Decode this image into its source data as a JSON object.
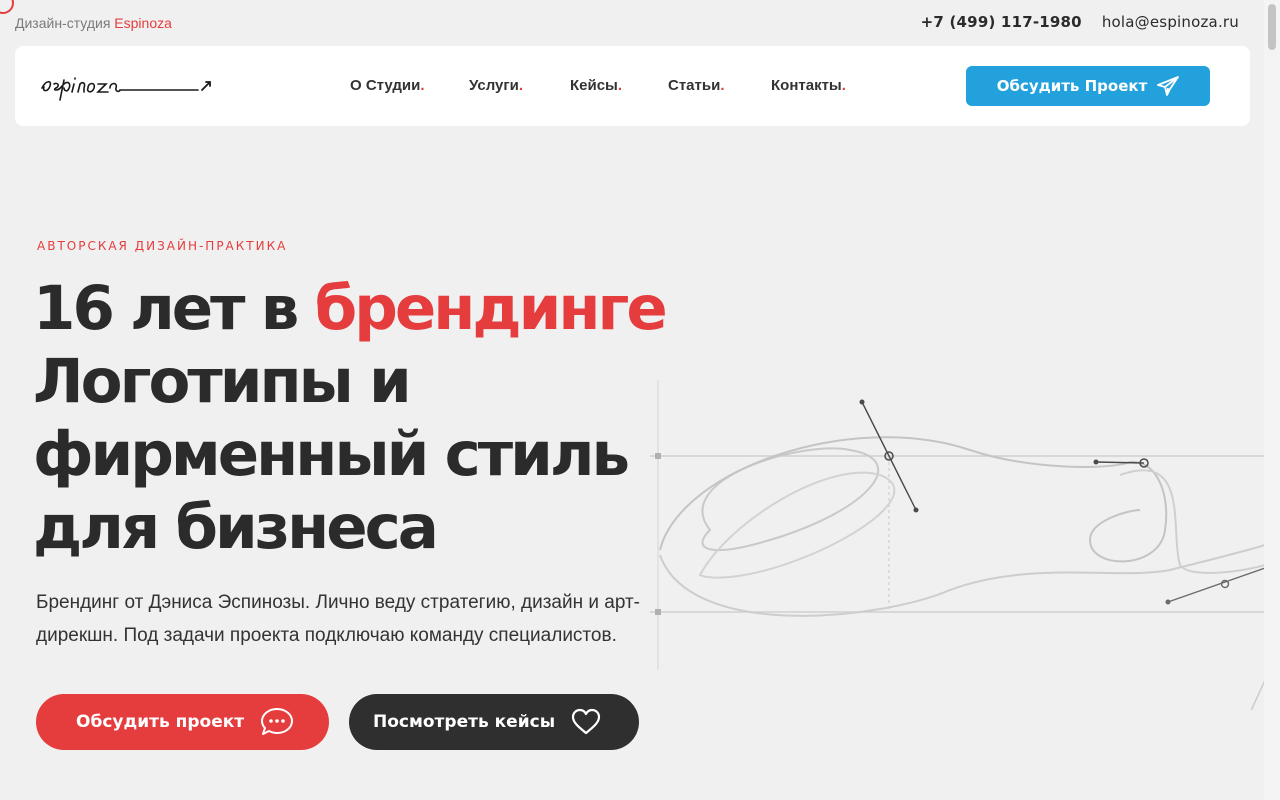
{
  "topbar": {
    "brand_prefix": "Дизайн-студия",
    "brand_name": "Espinoza",
    "phone": "+7 (499) 117-1980",
    "email": "hola@espinoza.ru"
  },
  "nav": {
    "items": [
      {
        "label": "О Студии",
        "dot": "."
      },
      {
        "label": "Услуги",
        "dot": "."
      },
      {
        "label": "Кейсы",
        "dot": "."
      },
      {
        "label": "Статьи",
        "dot": "."
      },
      {
        "label": "Контакты",
        "dot": "."
      }
    ],
    "cta_label": "Обсудить Проект",
    "cta_icon": "paper-plane-icon"
  },
  "hero": {
    "eyebrow": "АВТОРСКАЯ ДИЗАЙН-ПРАКТИКА",
    "headline_part1": "16 лет в ",
    "headline_accent": "брендинге",
    "headline_part2": "Логотипы и фирменный стиль для бизнеса",
    "subtitle": "Брендинг от Дэниса Эспинозы. Лично веду стратегию, дизайн и арт-дирекшн. Под задачи проекта подключаю команду специалистов.",
    "primary_button": "Обсудить проект",
    "primary_icon": "chat-bubble-icon",
    "secondary_button": "Посмотреть кейсы",
    "secondary_icon": "heart-icon"
  },
  "colors": {
    "accent": "#e53d3d",
    "blue": "#23a1dc",
    "dark": "#2f2f2f",
    "background": "#f0f0f1"
  }
}
